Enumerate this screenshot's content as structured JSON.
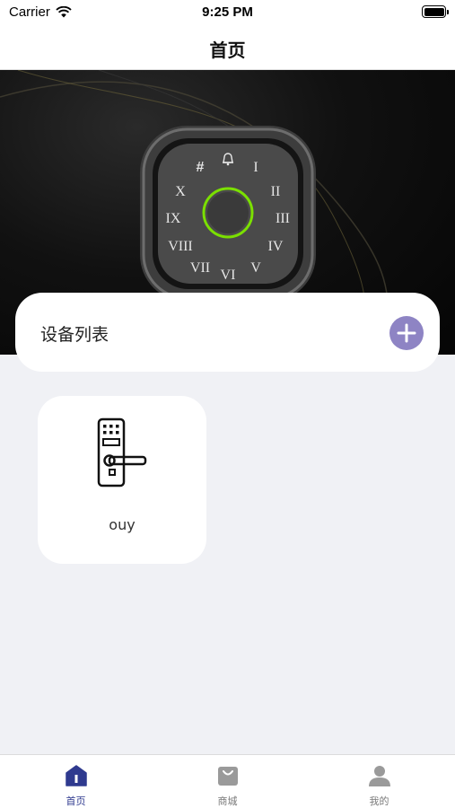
{
  "status_bar": {
    "carrier": "Carrier",
    "time": "9:25 PM",
    "icons": [
      "wifi-icon",
      "battery-icon"
    ]
  },
  "nav": {
    "title": "首页"
  },
  "banner": {
    "image": "smart-lock-keypad",
    "keypad_symbols": [
      "#",
      "I",
      "II",
      "III",
      "IV",
      "V",
      "VI",
      "VII",
      "VIII",
      "IX",
      "X"
    ]
  },
  "device_list": {
    "title": "设备列表",
    "add_icon": "plus-icon"
  },
  "devices": [
    {
      "name": "ouy",
      "icon": "door-lock-icon"
    }
  ],
  "tabbar": {
    "items": [
      {
        "label": "首页",
        "icon": "home-icon",
        "active": true
      },
      {
        "label": "商城",
        "icon": "shopping-bag-icon",
        "active": false
      },
      {
        "label": "我的",
        "icon": "user-icon",
        "active": false
      }
    ]
  },
  "colors": {
    "accent": "#8e84c4",
    "tab_active": "#2f3a8f",
    "tab_inactive": "#9a9a9a",
    "background": "#f0f1f5",
    "ring_green": "#7be000"
  }
}
